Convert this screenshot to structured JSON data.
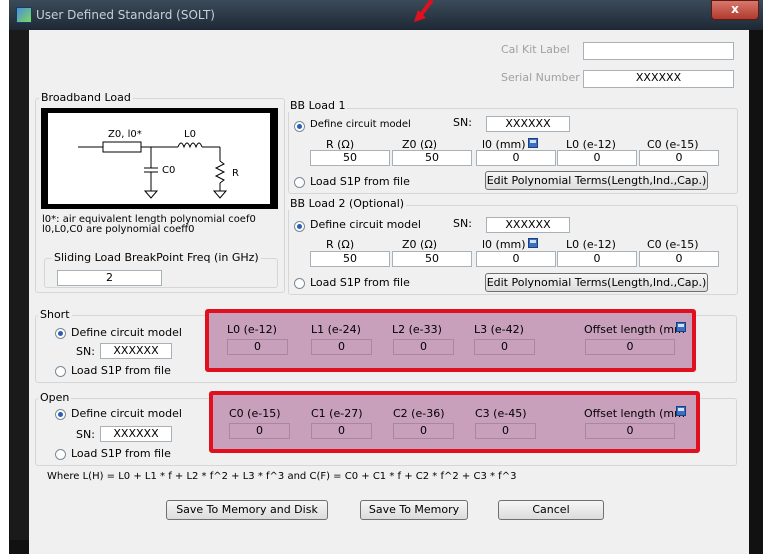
{
  "window": {
    "title": "User Defined Standard (SOLT)",
    "close_glyph": "x"
  },
  "header": {
    "cal_kit_label": "Cal Kit Label",
    "cal_kit_value": "",
    "serial_number_label": "Serial Number",
    "serial_number_value": "XXXXXX"
  },
  "broadband": {
    "title": "Broadband Load",
    "schematic": {
      "z_label": "Z0, l0*",
      "l_label": "L0",
      "c_label": "C0",
      "r_label": "R"
    },
    "note1": "l0*: air equivalent length polynomial coef0",
    "note2": "l0,L0,C0 are polynomial coeff0",
    "breakpoint_label": "Sliding Load BreakPoint Freq (in GHz)",
    "breakpoint_value": "2"
  },
  "bb_load1": {
    "title": "BB Load 1",
    "define_label": "Define circuit model",
    "sn_label": "SN:",
    "sn_value": "XXXXXX",
    "r_label": "R (Ω)",
    "z0_label": "Z0 (Ω)",
    "l0_label": "l0 (mm)",
    "L0_label": "L0 (e-12)",
    "C0_label": "C0 (e-15)",
    "r_value": "50",
    "z0_value": "50",
    "l0_value": "0",
    "L0_value": "0",
    "C0_value": "0",
    "s1p_label": "Load S1P from file",
    "edit_button": "Edit Polynomial Terms(Length,Ind.,Cap.)"
  },
  "bb_load2": {
    "title": "BB Load 2 (Optional)",
    "define_label": "Define circuit model",
    "sn_label": "SN:",
    "sn_value": "XXXXXX",
    "r_label": "R (Ω)",
    "z0_label": "Z0 (Ω)",
    "l0_label": "l0 (mm)",
    "L0_label": "L0 (e-12)",
    "C0_label": "C0 (e-15)",
    "r_value": "50",
    "z0_value": "50",
    "l0_value": "0",
    "L0_value": "0",
    "C0_value": "0",
    "s1p_label": "Load S1P from file",
    "edit_button": "Edit Polynomial Terms(Length,Ind.,Cap.)"
  },
  "short": {
    "title": "Short",
    "define_label": "Define circuit model",
    "sn_label": "SN:",
    "sn_value": "XXXXXX",
    "s1p_label": "Load S1P from file",
    "cols": [
      {
        "label": "L0 (e-12)",
        "value": "0"
      },
      {
        "label": "L1 (e-24)",
        "value": "0"
      },
      {
        "label": "L2 (e-33)",
        "value": "0"
      },
      {
        "label": "L3 (e-42)",
        "value": "0"
      }
    ],
    "offset_label": "Offset length (mm",
    "offset_value": "0"
  },
  "open": {
    "title": "Open",
    "define_label": "Define circuit model",
    "sn_label": "SN:",
    "sn_value": "XXXXXX",
    "s1p_label": "Load S1P from file",
    "cols": [
      {
        "label": "C0 (e-15)",
        "value": "0"
      },
      {
        "label": "C1 (e-27)",
        "value": "0"
      },
      {
        "label": "C2 (e-36)",
        "value": "0"
      },
      {
        "label": "C3 (e-45)",
        "value": "0"
      }
    ],
    "offset_label": "Offset length (mm",
    "offset_value": "0"
  },
  "formula": "Where L(H) = L0 + L1 * f + L2 * f^2 + L3 * f^3  and  C(F) = C0 + C1 * f + C2 * f^2 + C3 * f^3",
  "buttons": {
    "save_disk": "Save To Memory and Disk",
    "save_memory": "Save To Memory",
    "cancel": "Cancel"
  },
  "colors": {
    "highlight_border": "#e0101e",
    "highlight_fill": "#c8a0bc",
    "arrow": "#e0101e"
  },
  "icons": [
    "app-icon",
    "close-icon",
    "calculator-icon",
    "red-arrow-annotation"
  ]
}
